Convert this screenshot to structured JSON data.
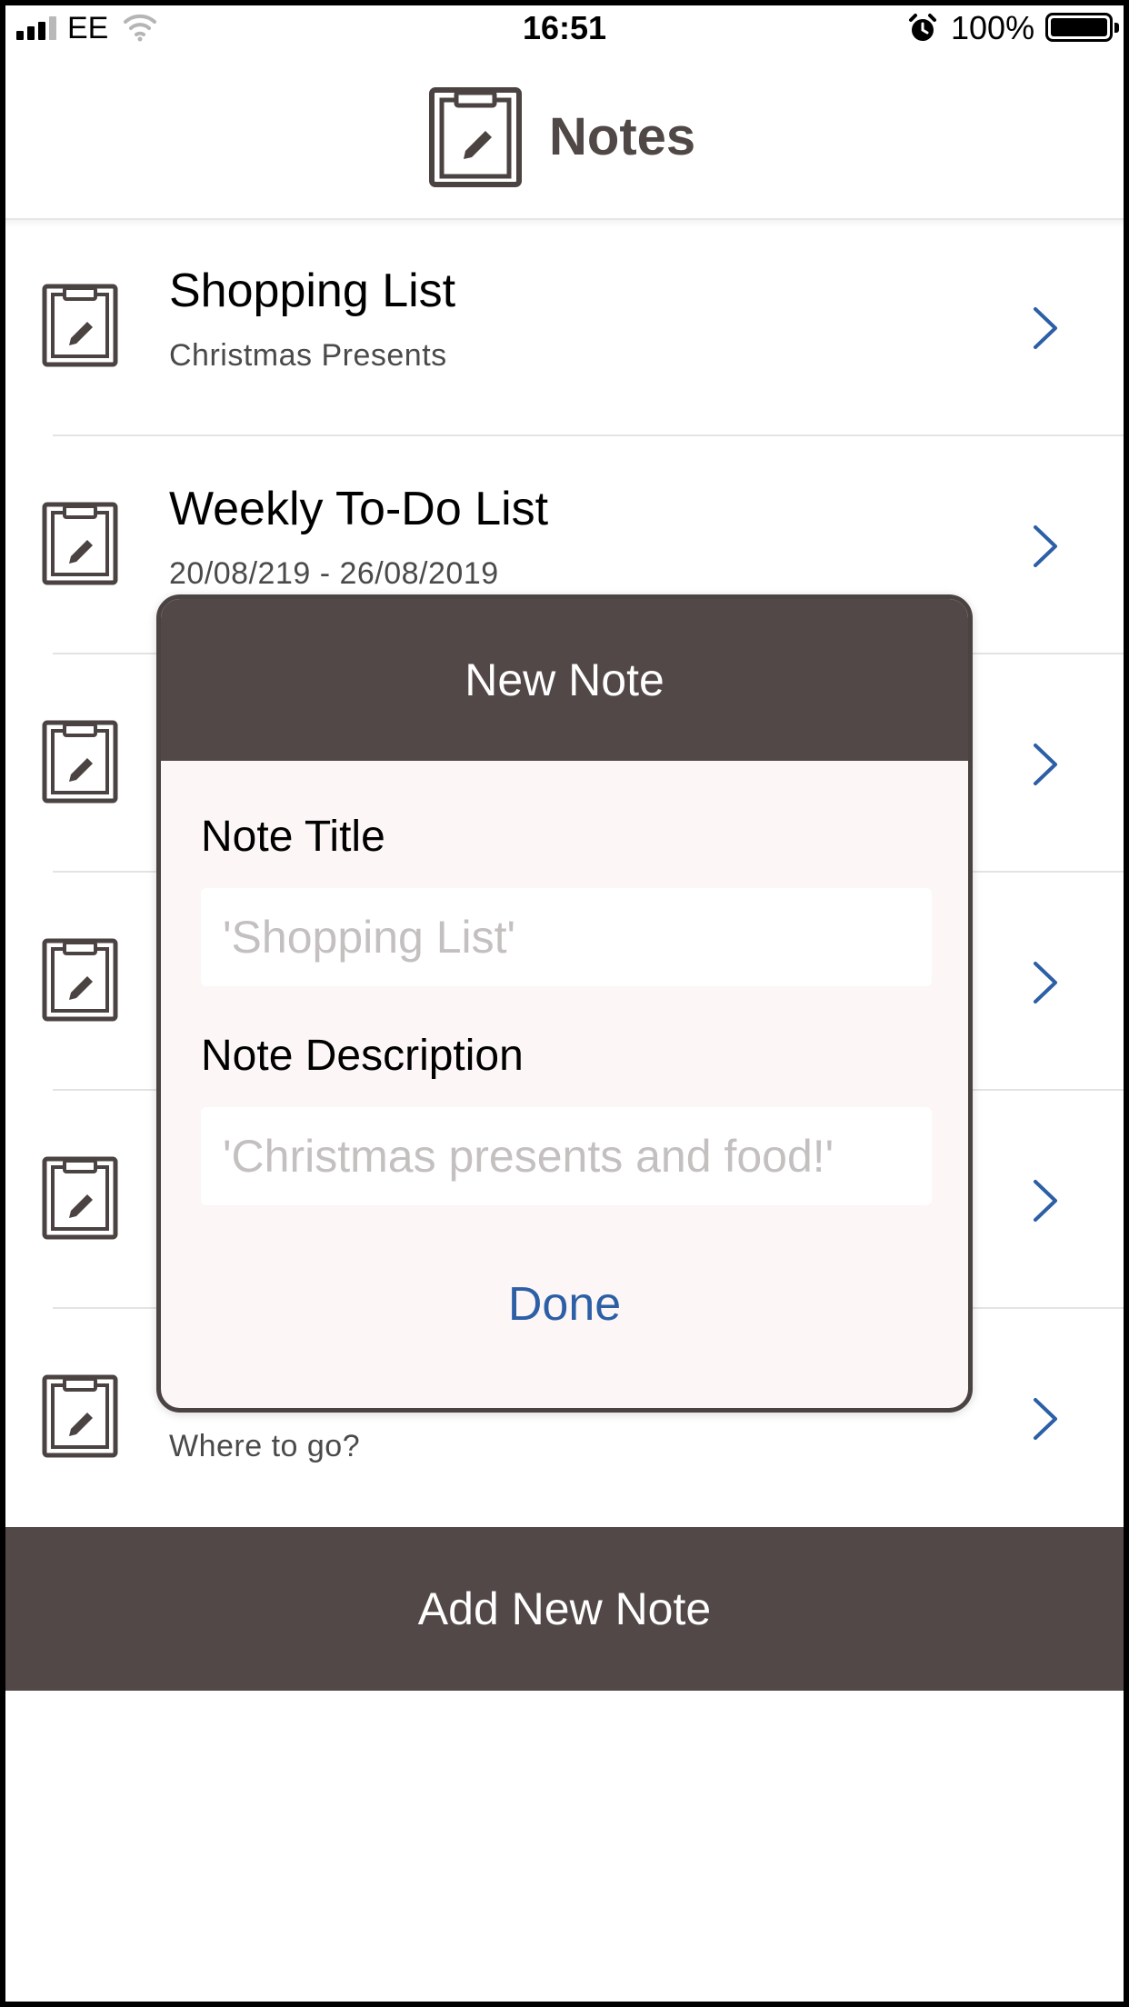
{
  "status_bar": {
    "carrier": "EE",
    "time": "16:51",
    "battery": "100%",
    "battery_level": 1.0
  },
  "header": {
    "title": "Notes",
    "icon": "clipboard-edit-icon"
  },
  "notes": [
    {
      "title": "Shopping List",
      "subtitle": "Christmas Presents"
    },
    {
      "title": "Weekly To-Do List",
      "subtitle": "20/08/219 - 26/08/2019"
    },
    {
      "title": "",
      "subtitle": ""
    },
    {
      "title": "",
      "subtitle": ""
    },
    {
      "title": "",
      "subtitle": ""
    },
    {
      "title": "",
      "subtitle": "Where to go?"
    }
  ],
  "add_button": {
    "label": "Add New Note"
  },
  "modal": {
    "title": "New Note",
    "title_field": {
      "label": "Note Title",
      "placeholder": "'Shopping List'",
      "value": ""
    },
    "description_field": {
      "label": "Note Description",
      "placeholder": "'Christmas presents and food!'",
      "value": ""
    },
    "done_label": "Done"
  },
  "colors": {
    "bar_brown": "#524847",
    "chevron_blue": "#2c5fa6",
    "modal_bg": "#fcf6f6"
  }
}
